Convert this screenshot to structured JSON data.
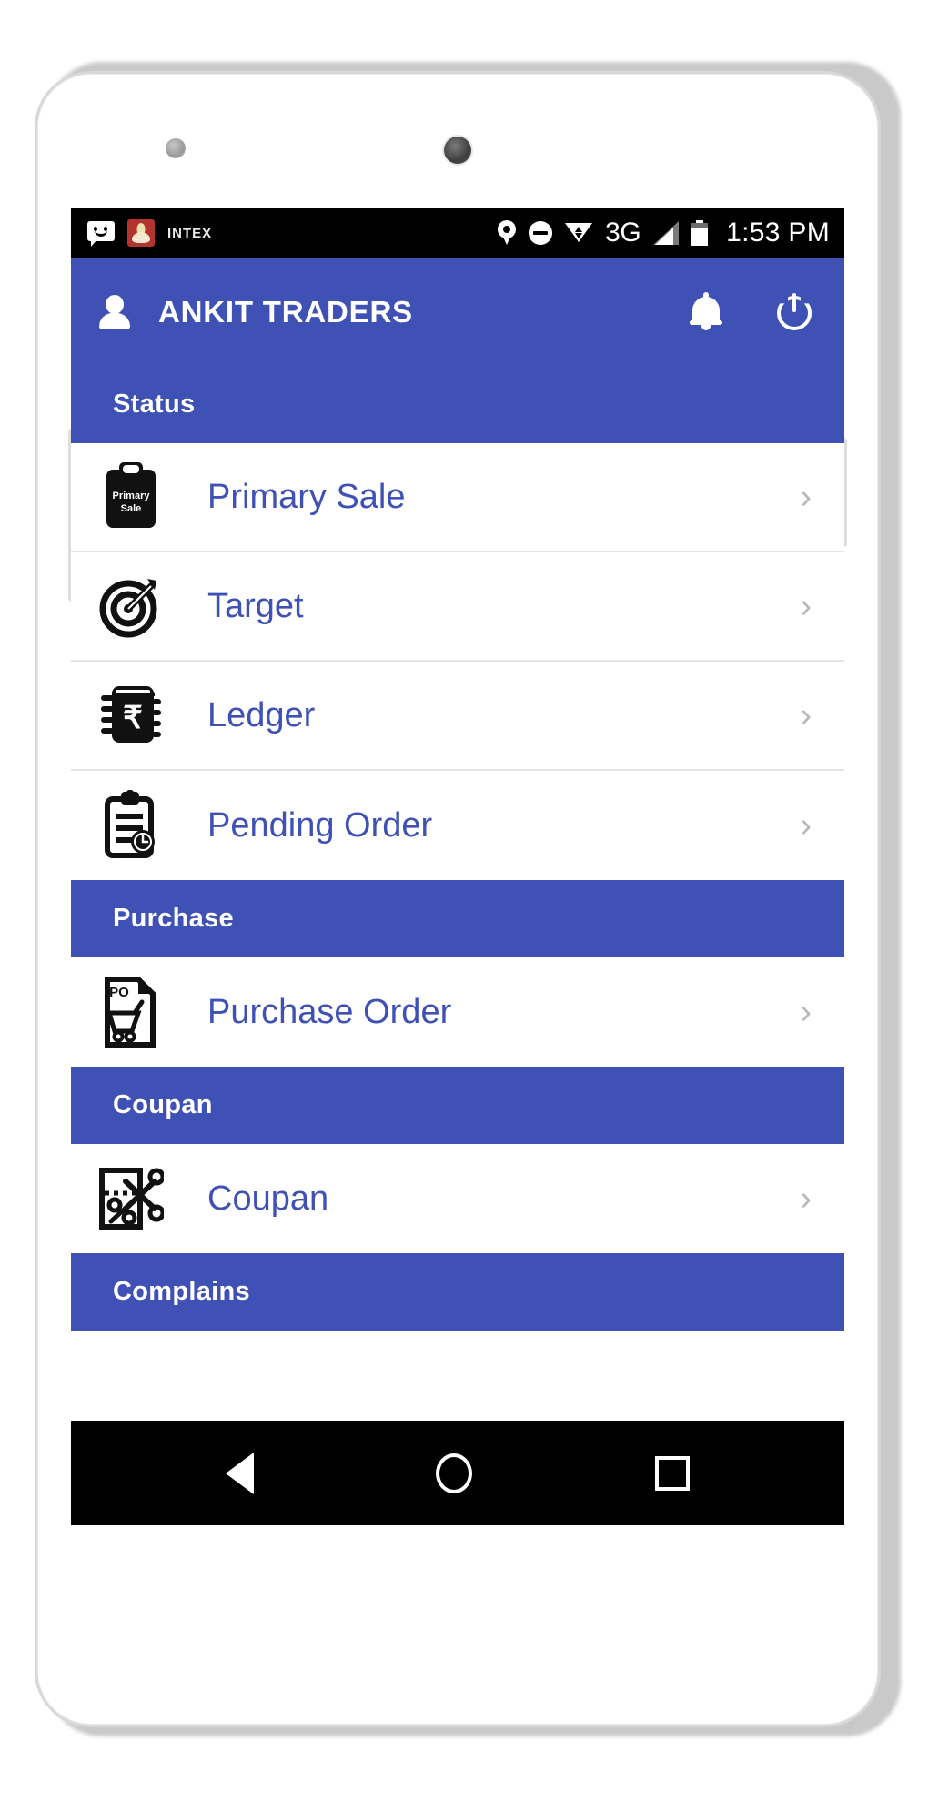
{
  "device": {
    "type": "android-phone-mockup"
  },
  "status_bar": {
    "carrier_label": "INTEX",
    "network_type": "3G",
    "time": "1:53 PM",
    "icons": [
      "sms-icon",
      "intex-logo-icon",
      "location-pin-icon",
      "do-not-disturb-icon",
      "wifi-icon",
      "signal-bars-icon",
      "battery-icon"
    ]
  },
  "app_bar": {
    "title": "ANKIT TRADERS",
    "avatar_icon": "person-icon",
    "actions": [
      {
        "name": "notifications-button",
        "icon": "bell-icon"
      },
      {
        "name": "power-logout-button",
        "icon": "power-icon"
      }
    ]
  },
  "theme": {
    "primary": "#3f51b5",
    "link_text": "#3f51b5",
    "divider": "#e4e4e4",
    "status_bar_bg": "#000000",
    "nav_bar_bg": "#000000",
    "screen_bg": "#ffffff"
  },
  "sections": [
    {
      "header": "Status",
      "items": [
        {
          "label": "Primary Sale",
          "icon": "clipboard-primary-sale-icon",
          "chevron": "›"
        },
        {
          "label": "Target",
          "icon": "target-bullseye-icon",
          "chevron": "›"
        },
        {
          "label": "Ledger",
          "icon": "ledger-rupee-book-icon",
          "chevron": "›"
        },
        {
          "label": "Pending Order",
          "icon": "clipboard-clock-icon",
          "chevron": "›"
        }
      ]
    },
    {
      "header": "Purchase",
      "items": [
        {
          "label": "Purchase Order",
          "icon": "purchase-order-document-icon",
          "chevron": "›"
        }
      ]
    },
    {
      "header": "Coupan",
      "items": [
        {
          "label": "Coupan",
          "icon": "coupon-scissors-icon",
          "chevron": "›"
        }
      ]
    },
    {
      "header": "Complains",
      "items": []
    }
  ],
  "icon_text": {
    "primary_sale_line1": "Primary",
    "primary_sale_line2": "Sale",
    "purchase_order_tag": "PO",
    "ledger_currency": "₹"
  },
  "nav_bar": {
    "buttons": [
      {
        "name": "nav-back-button",
        "icon": "back-triangle-icon"
      },
      {
        "name": "nav-home-button",
        "icon": "home-circle-icon"
      },
      {
        "name": "nav-recents-button",
        "icon": "recents-square-icon"
      }
    ]
  }
}
